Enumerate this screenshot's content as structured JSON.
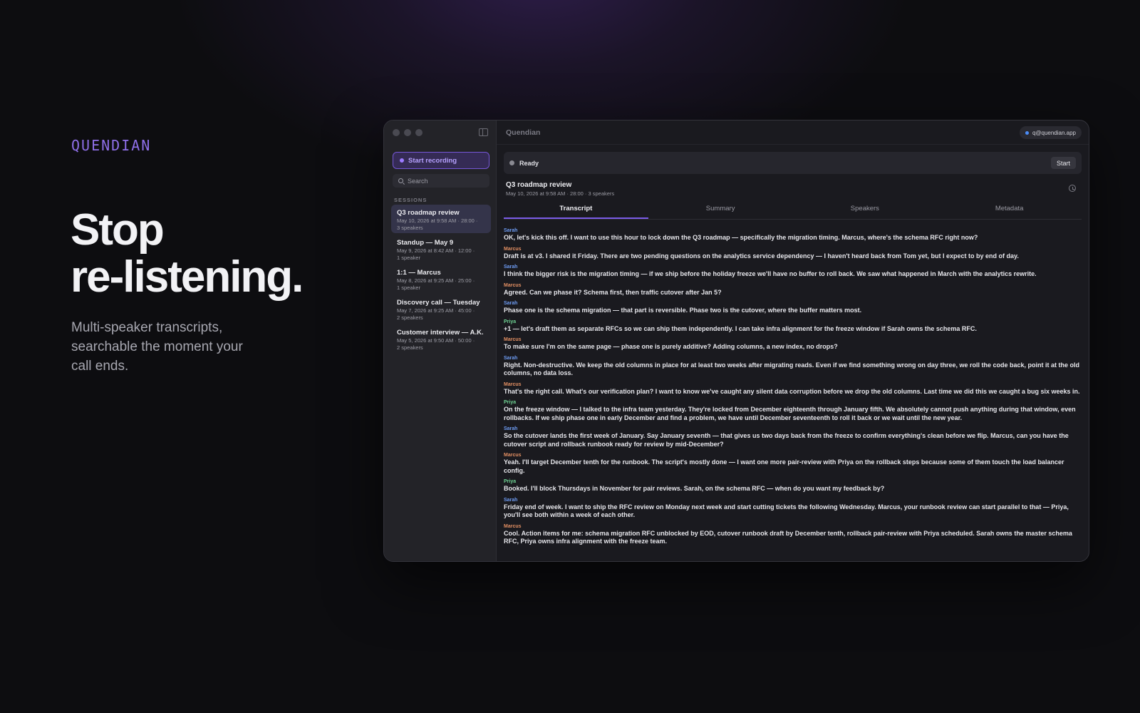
{
  "brand": "QUENDIAN",
  "hero": {
    "headline_line1": "Stop",
    "headline_line2": "re-listening.",
    "tagline": "Multi-speaker transcripts, searchable the moment your call ends."
  },
  "app": {
    "title": "Quendian",
    "account": "q@quendian.app",
    "sidebar": {
      "record_label": "Start recording",
      "search_placeholder": "Search",
      "section_label": "SESSIONS",
      "sessions": [
        {
          "title": "Q3 roadmap review",
          "meta1": "May 10, 2026 at 9:58 AM · 28:00 ·",
          "meta2": "3 speakers"
        },
        {
          "title": "Standup — May 9",
          "meta1": "May 9, 2026 at 8:42 AM · 12:00 ·",
          "meta2": "1 speaker"
        },
        {
          "title": "1:1 — Marcus",
          "meta1": "May 8, 2026 at 9:25 AM · 25:00 ·",
          "meta2": "1 speaker"
        },
        {
          "title": "Discovery call — Tuesday",
          "meta1": "May 7, 2026 at 9:25 AM · 45:00 ·",
          "meta2": "2 speakers"
        },
        {
          "title": "Customer interview — A.K.",
          "meta1": "May 5, 2026 at 9:50 AM · 50:00 ·",
          "meta2": "2 speakers"
        }
      ]
    },
    "status": {
      "text": "Ready",
      "start_label": "Start"
    },
    "session": {
      "title": "Q3 roadmap review",
      "meta": "May 10, 2026 at 9:58 AM · 28:00 · 3 speakers"
    },
    "tabs": [
      "Transcript",
      "Summary",
      "Speakers",
      "Metadata"
    ],
    "colors": {
      "accent": "#7b5ce8",
      "sarah": "#6e9cf3",
      "marcus": "#e08e62",
      "priya": "#6fd293"
    },
    "transcript": [
      {
        "speaker": "Sarah",
        "text": "OK, let's kick this off. I want to use this hour to lock down the Q3 roadmap — specifically the migration timing. Marcus, where's the schema RFC right now?"
      },
      {
        "speaker": "Marcus",
        "text": "Draft is at v3. I shared it Friday. There are two pending questions on the analytics service dependency — I haven't heard back from Tom yet, but I expect to by end of day."
      },
      {
        "speaker": "Sarah",
        "text": "I think the bigger risk is the migration timing — if we ship before the holiday freeze we'll have no buffer to roll back. We saw what happened in March with the analytics rewrite."
      },
      {
        "speaker": "Marcus",
        "text": "Agreed. Can we phase it? Schema first, then traffic cutover after Jan 5?"
      },
      {
        "speaker": "Sarah",
        "text": "Phase one is the schema migration — that part is reversible. Phase two is the cutover, where the buffer matters most."
      },
      {
        "speaker": "Priya",
        "text": "+1 — let's draft them as separate RFCs so we can ship them independently. I can take infra alignment for the freeze window if Sarah owns the schema RFC."
      },
      {
        "speaker": "Marcus",
        "text": "To make sure I'm on the same page — phase one is purely additive? Adding columns, a new index, no drops?"
      },
      {
        "speaker": "Sarah",
        "text": "Right. Non-destructive. We keep the old columns in place for at least two weeks after migrating reads. Even if we find something wrong on day three, we roll the code back, point it at the old columns, no data loss."
      },
      {
        "speaker": "Marcus",
        "text": "That's the right call. What's our verification plan? I want to know we've caught any silent data corruption before we drop the old columns. Last time we did this we caught a bug six weeks in."
      },
      {
        "speaker": "Priya",
        "text": "On the freeze window — I talked to the infra team yesterday. They're locked from December eighteenth through January fifth. We absolutely cannot push anything during that window, even rollbacks. If we ship phase one in early December and find a problem, we have until December seventeenth to roll it back or we wait until the new year."
      },
      {
        "speaker": "Sarah",
        "text": "So the cutover lands the first week of January. Say January seventh — that gives us two days back from the freeze to confirm everything's clean before we flip. Marcus, can you have the cutover script and rollback runbook ready for review by mid-December?"
      },
      {
        "speaker": "Marcus",
        "text": "Yeah. I'll target December tenth for the runbook. The script's mostly done — I want one more pair-review with Priya on the rollback steps because some of them touch the load balancer config."
      },
      {
        "speaker": "Priya",
        "text": "Booked. I'll block Thursdays in November for pair reviews. Sarah, on the schema RFC — when do you want my feedback by?"
      },
      {
        "speaker": "Sarah",
        "text": "Friday end of week. I want to ship the RFC review on Monday next week and start cutting tickets the following Wednesday. Marcus, your runbook review can start parallel to that — Priya, you'll see both within a week of each other."
      },
      {
        "speaker": "Marcus",
        "text": "Cool. Action items for me: schema migration RFC unblocked by EOD, cutover runbook draft by December tenth, rollback pair-review with Priya scheduled. Sarah owns the master schema RFC, Priya owns infra alignment with the freeze team."
      }
    ]
  }
}
